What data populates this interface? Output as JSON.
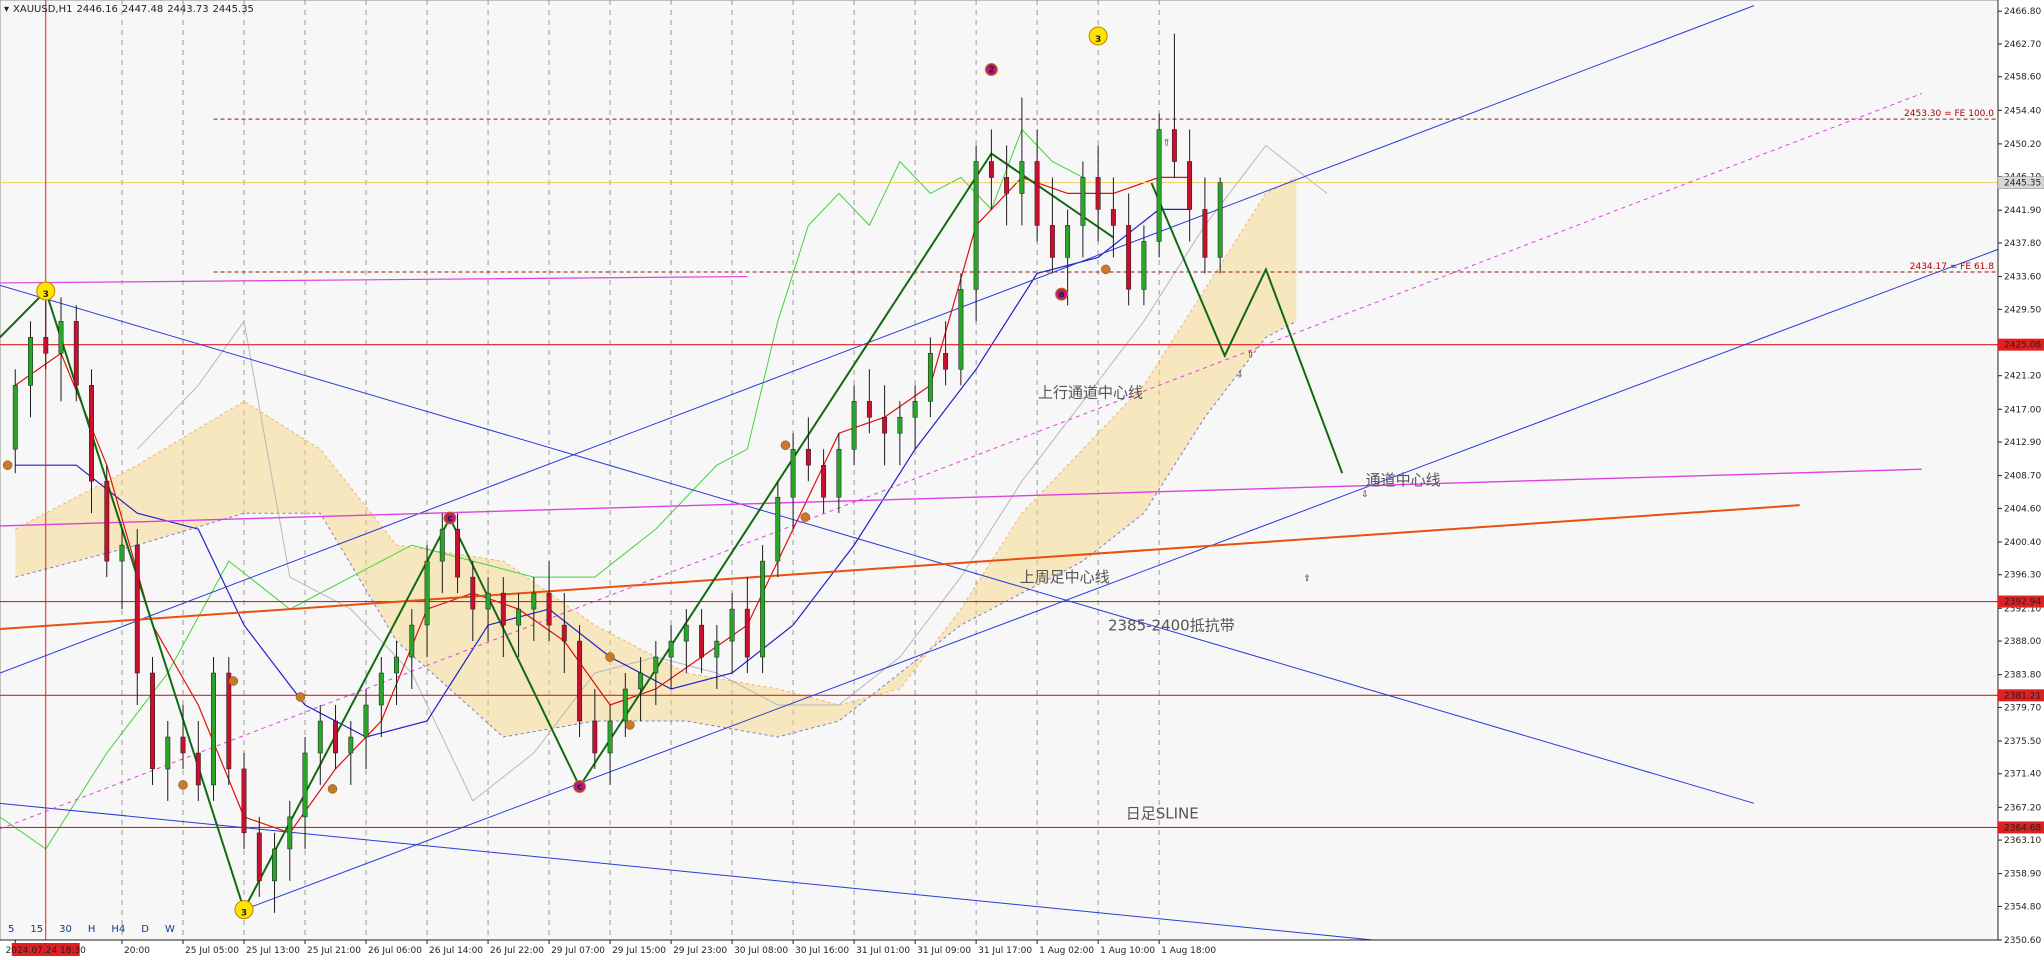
{
  "header": {
    "menu_icon": "triangle-down-icon",
    "symbol": "XAUUSD,H1",
    "open": "2446.16",
    "high": "2447.48",
    "low": "2443.73",
    "close": "2445.35"
  },
  "timeframes": [
    "5",
    "15",
    "30",
    "H",
    "H4",
    "D",
    "W"
  ],
  "current_price": "2445.35",
  "highlighted_time": "2024.07.24 18:30",
  "chart_data": {
    "type": "candlestick",
    "symbol": "XAUUSD",
    "timeframe": "H1",
    "ylim": [
      2350.6,
      2468.2
    ],
    "xlim": [
      -1,
      130
    ],
    "y_ticks": [
      "2466.80",
      "2462.70",
      "2458.60",
      "2454.40",
      "2450.20",
      "2446.10",
      "2441.90",
      "2437.80",
      "2433.60",
      "2429.50",
      "2425.30",
      "2421.20",
      "2417.00",
      "2412.90",
      "2408.70",
      "2404.60",
      "2400.40",
      "2396.30",
      "2392.10",
      "2388.00",
      "2383.80",
      "2379.70",
      "2375.50",
      "2371.40",
      "2367.20",
      "2363.10",
      "2358.90",
      "2354.80",
      "2350.60"
    ],
    "x_ticks": [
      {
        "i": 0,
        "label": "24 "
      },
      {
        "i": 7,
        "label": "20:00"
      },
      {
        "i": 11,
        "label": "25 Jul 05:00"
      },
      {
        "i": 15,
        "label": "25 Jul 13:00"
      },
      {
        "i": 19,
        "label": "25 Jul 21:00"
      },
      {
        "i": 23,
        "label": "26 Jul 06:00"
      },
      {
        "i": 27,
        "label": "26 Jul 14:00"
      },
      {
        "i": 31,
        "label": "26 Jul 22:00"
      },
      {
        "i": 35,
        "label": "29 Jul 07:00"
      },
      {
        "i": 39,
        "label": "29 Jul 15:00"
      },
      {
        "i": 43,
        "label": "29 Jul 23:00"
      },
      {
        "i": 47,
        "label": "30 Jul 08:00"
      },
      {
        "i": 51,
        "label": "30 Jul 16:00"
      },
      {
        "i": 55,
        "label": "31 Jul 01:00"
      },
      {
        "i": 59,
        "label": "31 Jul 09:00"
      },
      {
        "i": 63,
        "label": "31 Jul 17:00"
      },
      {
        "i": 67,
        "label": "1 Aug 02:00"
      },
      {
        "i": 71,
        "label": "1 Aug 10:00"
      },
      {
        "i": 75,
        "label": "1 Aug 18:00"
      }
    ],
    "candles": [
      [
        2412,
        2422,
        2409,
        2420
      ],
      [
        2420,
        2428,
        2416,
        2426
      ],
      [
        2426,
        2432,
        2422,
        2424
      ],
      [
        2424,
        2431,
        2418,
        2428
      ],
      [
        2428,
        2430,
        2418,
        2420
      ],
      [
        2420,
        2422,
        2404,
        2408
      ],
      [
        2408,
        2410,
        2396,
        2398
      ],
      [
        2398,
        2402,
        2392,
        2400
      ],
      [
        2400,
        2402,
        2380,
        2384
      ],
      [
        2384,
        2386,
        2370,
        2372
      ],
      [
        2372,
        2378,
        2368,
        2376
      ],
      [
        2376,
        2380,
        2372,
        2374
      ],
      [
        2374,
        2378,
        2368,
        2370
      ],
      [
        2370,
        2386,
        2368,
        2384
      ],
      [
        2384,
        2386,
        2370,
        2372
      ],
      [
        2372,
        2374,
        2362,
        2364
      ],
      [
        2364,
        2366,
        2356,
        2358
      ],
      [
        2358,
        2364,
        2354,
        2362
      ],
      [
        2362,
        2368,
        2358,
        2366
      ],
      [
        2366,
        2376,
        2362,
        2374
      ],
      [
        2374,
        2380,
        2370,
        2378
      ],
      [
        2378,
        2380,
        2372,
        2374
      ],
      [
        2374,
        2378,
        2370,
        2376
      ],
      [
        2376,
        2382,
        2372,
        2380
      ],
      [
        2380,
        2386,
        2376,
        2384
      ],
      [
        2384,
        2388,
        2380,
        2386
      ],
      [
        2386,
        2392,
        2382,
        2390
      ],
      [
        2390,
        2400,
        2386,
        2398
      ],
      [
        2398,
        2404,
        2394,
        2402
      ],
      [
        2402,
        2404,
        2394,
        2396
      ],
      [
        2396,
        2398,
        2388,
        2392
      ],
      [
        2392,
        2396,
        2388,
        2394
      ],
      [
        2394,
        2396,
        2386,
        2390
      ],
      [
        2390,
        2394,
        2386,
        2392
      ],
      [
        2392,
        2396,
        2388,
        2394
      ],
      [
        2394,
        2398,
        2388,
        2390
      ],
      [
        2390,
        2394,
        2384,
        2388
      ],
      [
        2388,
        2390,
        2376,
        2378
      ],
      [
        2378,
        2382,
        2372,
        2374
      ],
      [
        2374,
        2380,
        2370,
        2378
      ],
      [
        2378,
        2384,
        2376,
        2382
      ],
      [
        2382,
        2386,
        2378,
        2384
      ],
      [
        2384,
        2388,
        2380,
        2386
      ],
      [
        2386,
        2390,
        2382,
        2388
      ],
      [
        2388,
        2392,
        2384,
        2390
      ],
      [
        2390,
        2392,
        2384,
        2386
      ],
      [
        2386,
        2390,
        2382,
        2388
      ],
      [
        2388,
        2394,
        2384,
        2392
      ],
      [
        2392,
        2396,
        2384,
        2386
      ],
      [
        2386,
        2400,
        2384,
        2398
      ],
      [
        2398,
        2408,
        2396,
        2406
      ],
      [
        2406,
        2414,
        2402,
        2412
      ],
      [
        2412,
        2416,
        2408,
        2410
      ],
      [
        2410,
        2412,
        2404,
        2406
      ],
      [
        2406,
        2414,
        2404,
        2412
      ],
      [
        2412,
        2420,
        2410,
        2418
      ],
      [
        2418,
        2422,
        2414,
        2416
      ],
      [
        2416,
        2420,
        2410,
        2414
      ],
      [
        2414,
        2418,
        2410,
        2416
      ],
      [
        2416,
        2420,
        2412,
        2418
      ],
      [
        2418,
        2426,
        2416,
        2424
      ],
      [
        2424,
        2428,
        2420,
        2422
      ],
      [
        2422,
        2434,
        2420,
        2432
      ],
      [
        2432,
        2450,
        2428,
        2448
      ],
      [
        2448,
        2452,
        2442,
        2446
      ],
      [
        2446,
        2450,
        2440,
        2444
      ],
      [
        2444,
        2456,
        2440,
        2448
      ],
      [
        2448,
        2452,
        2438,
        2440
      ],
      [
        2440,
        2446,
        2434,
        2436
      ],
      [
        2436,
        2442,
        2430,
        2440
      ],
      [
        2440,
        2448,
        2436,
        2446
      ],
      [
        2446,
        2450,
        2438,
        2442
      ],
      [
        2442,
        2446,
        2436,
        2440
      ],
      [
        2440,
        2444,
        2430,
        2432
      ],
      [
        2432,
        2440,
        2430,
        2438
      ],
      [
        2438,
        2454,
        2436,
        2452
      ],
      [
        2452,
        2464,
        2446,
        2448
      ],
      [
        2448,
        2452,
        2438,
        2442
      ],
      [
        2442,
        2446,
        2434,
        2436
      ],
      [
        2436,
        2446,
        2434,
        2445.35
      ]
    ],
    "price_levels": [
      {
        "price": "2425.08",
        "color": "#e02020"
      },
      {
        "price": "2392.94",
        "color": "#e02020"
      },
      {
        "price": "2381.21",
        "color": "#e02020"
      },
      {
        "price": "2364.68",
        "color": "#e02020"
      }
    ],
    "fib_levels": [
      {
        "price": 2453.3,
        "label": "2453.30 = FE 100.0"
      },
      {
        "price": 2434.17,
        "label": "2434.17 = FE 61.8"
      }
    ],
    "annotations": [
      {
        "text": "上行通道中心线",
        "x": 70.5,
        "y": 2418.5
      },
      {
        "text": "通道中心线",
        "x": 91,
        "y": 2407.5
      },
      {
        "text": "上周足中心线",
        "x": 68.8,
        "y": 2395.4
      },
      {
        "text": "2385-2400抵抗带",
        "x": 75.8,
        "y": 2389.3
      },
      {
        "text": "日足SLINE",
        "x": 75.2,
        "y": 2365.8
      }
    ],
    "wave_labels": [
      {
        "text": "3",
        "x": 2,
        "y": 2431.8,
        "kind": "yellow"
      },
      {
        "text": "3",
        "x": 15,
        "y": 2354.4,
        "kind": "yellow"
      },
      {
        "text": "3",
        "x": 71,
        "y": 2463.7,
        "kind": "yellow"
      },
      {
        "text": "2",
        "x": 64,
        "y": 2459.5,
        "kind": "magenta"
      },
      {
        "text": "c",
        "x": 28.5,
        "y": 2403.4,
        "kind": "magenta"
      },
      {
        "text": "c",
        "x": 37,
        "y": 2369.8,
        "kind": "magenta"
      },
      {
        "text": "a",
        "x": 68.6,
        "y": 2431.4,
        "kind": "magenta"
      }
    ],
    "forecast_path": [
      [
        74.5,
        2445.3
      ],
      [
        79.3,
        2423.7
      ],
      [
        82,
        2434.5
      ],
      [
        87,
        2409
      ]
    ]
  }
}
